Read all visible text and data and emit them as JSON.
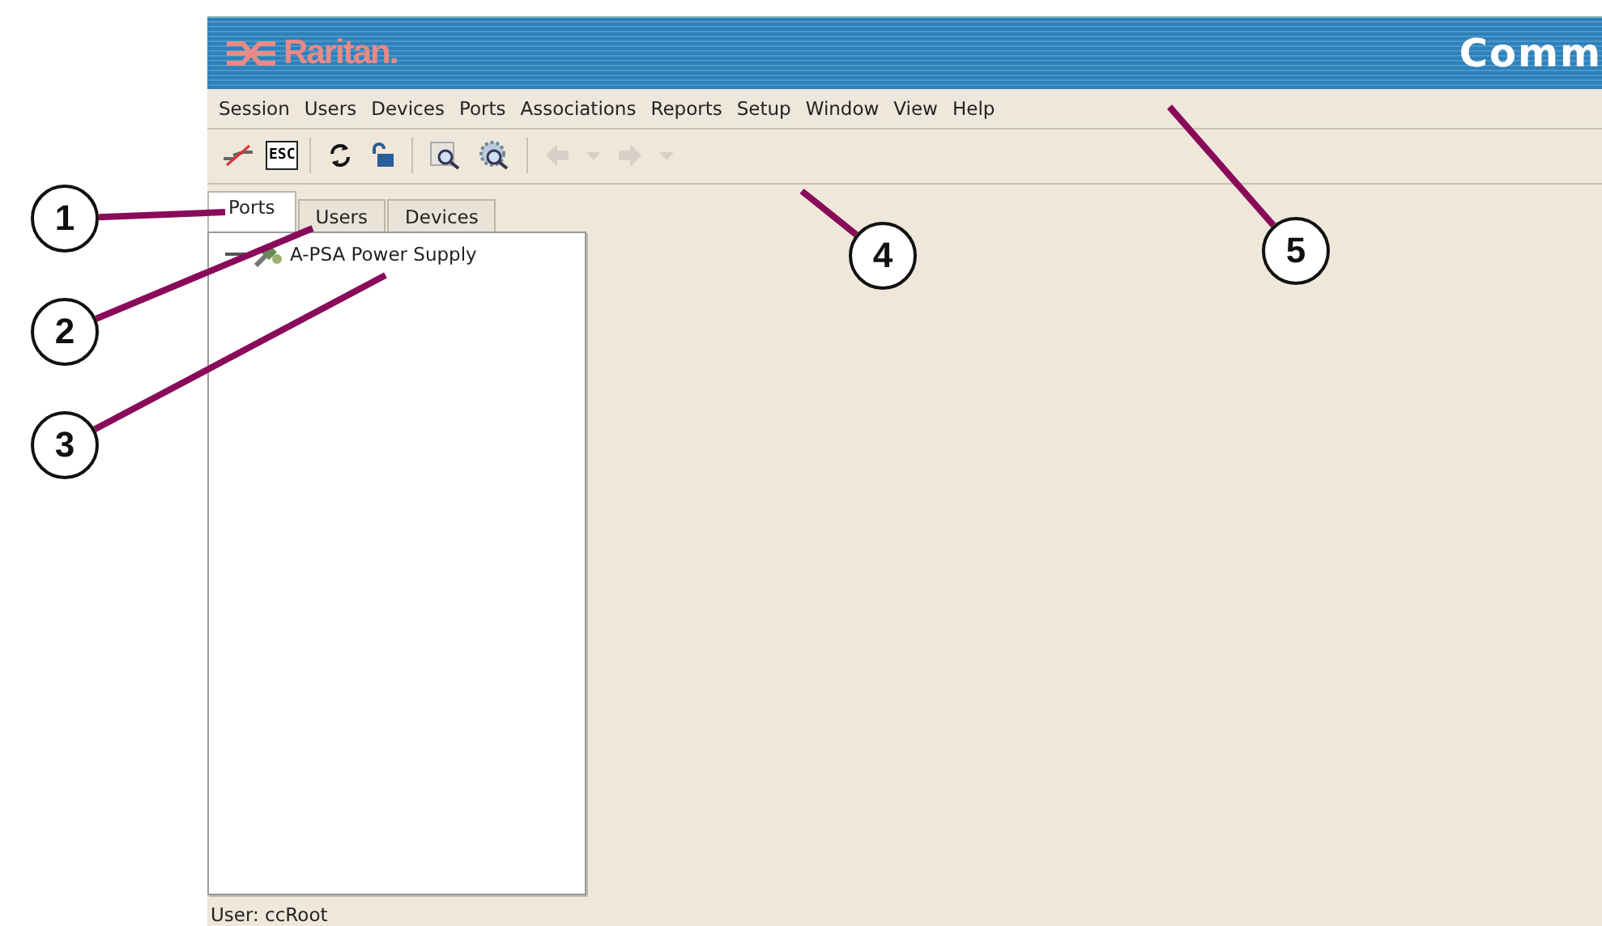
{
  "header": {
    "logo": "Raritan.",
    "title": "Comm"
  },
  "menu": [
    "Session",
    "Users",
    "Devices",
    "Ports",
    "Associations",
    "Reports",
    "Setup",
    "Window",
    "View",
    "Help"
  ],
  "toolbar": [
    {
      "kind": "disconnect",
      "disabled": false
    },
    {
      "kind": "esc",
      "label": "ESC",
      "disabled": false
    },
    {
      "kind": "sep"
    },
    {
      "kind": "refresh",
      "disabled": false
    },
    {
      "kind": "lock",
      "disabled": false
    },
    {
      "kind": "sep"
    },
    {
      "kind": "find",
      "disabled": false
    },
    {
      "kind": "find-gear",
      "disabled": false
    },
    {
      "kind": "sep"
    },
    {
      "kind": "back",
      "disabled": true
    },
    {
      "kind": "caret",
      "disabled": true
    },
    {
      "kind": "forward",
      "disabled": true
    },
    {
      "kind": "caret",
      "disabled": true
    }
  ],
  "tabs": [
    {
      "label": "Ports",
      "selected": true
    },
    {
      "label": "Users",
      "selected": false
    },
    {
      "label": "Devices",
      "selected": false
    }
  ],
  "tree": [
    {
      "label": "A-PSA Power Supply"
    }
  ],
  "status_bar": "User: ccRoot",
  "callouts": [
    {
      "label": "1"
    },
    {
      "label": "2"
    },
    {
      "label": "3"
    },
    {
      "label": "4"
    },
    {
      "label": "5"
    }
  ]
}
